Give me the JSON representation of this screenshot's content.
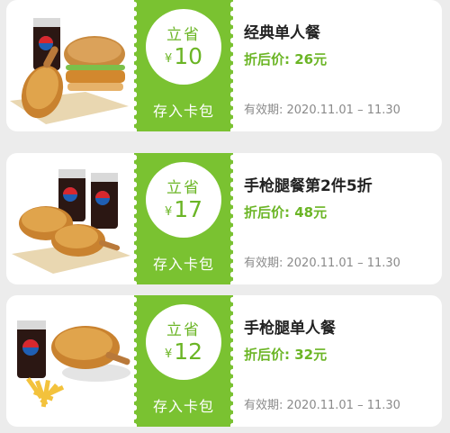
{
  "coupons": [
    {
      "save_label": "立省",
      "currency": "¥",
      "amount": "17",
      "button_label": "存入卡包",
      "title": "手枪腿餐第2件5折",
      "price_text": "折后价: 48元",
      "validity_text": "有效期: 2020.11.01 – 11.30",
      "image_items": [
        "cola-cup",
        "cola-cup",
        "drumstick",
        "drumstick"
      ]
    },
    {
      "save_label": "立省",
      "currency": "¥",
      "amount": "12",
      "button_label": "存入卡包",
      "title": "手枪腿单人餐",
      "price_text": "折后价: 32元",
      "validity_text": "有效期: 2020.11.01 – 11.30",
      "image_items": [
        "cola-cup",
        "drumstick",
        "fries"
      ]
    },
    {
      "save_label": "立省",
      "currency": "¥",
      "amount": "10",
      "button_label": "存入卡包",
      "title": "经典单人餐",
      "price_text": "折后价: 26元",
      "validity_text": "有效期: 2020.11.01 – 11.30",
      "image_items": [
        "cola-cup",
        "drumstick",
        "chicken-burger"
      ]
    }
  ],
  "colors": {
    "accent": "#7ac231",
    "accent_text": "#6bb525",
    "title": "#222222",
    "muted": "#8a8a8a",
    "background": "#ececec"
  }
}
